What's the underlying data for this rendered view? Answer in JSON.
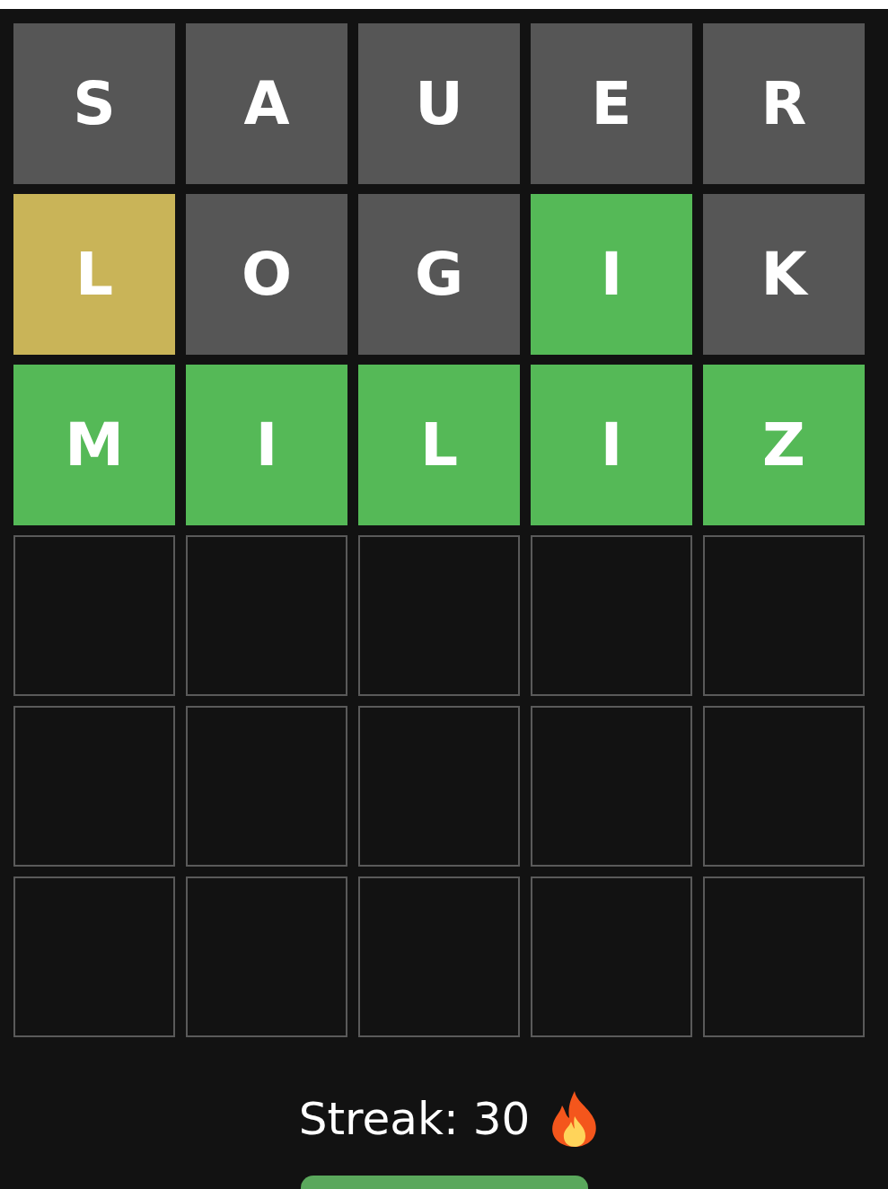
{
  "board": {
    "rows": [
      {
        "tiles": [
          {
            "letter": "S",
            "kind": "absent"
          },
          {
            "letter": "A",
            "kind": "absent"
          },
          {
            "letter": "U",
            "kind": "absent"
          },
          {
            "letter": "E",
            "kind": "absent"
          },
          {
            "letter": "R",
            "kind": "absent"
          }
        ]
      },
      {
        "tiles": [
          {
            "letter": "L",
            "kind": "present"
          },
          {
            "letter": "O",
            "kind": "absent"
          },
          {
            "letter": "G",
            "kind": "absent"
          },
          {
            "letter": "I",
            "kind": "correct"
          },
          {
            "letter": "K",
            "kind": "absent"
          }
        ]
      },
      {
        "tiles": [
          {
            "letter": "M",
            "kind": "correct"
          },
          {
            "letter": "I",
            "kind": "correct"
          },
          {
            "letter": "L",
            "kind": "correct"
          },
          {
            "letter": "I",
            "kind": "correct"
          },
          {
            "letter": "Z",
            "kind": "correct"
          }
        ]
      },
      {
        "tiles": [
          {
            "kind": "empty"
          },
          {
            "kind": "empty"
          },
          {
            "kind": "empty"
          },
          {
            "kind": "empty"
          },
          {
            "kind": "empty"
          }
        ]
      },
      {
        "tiles": [
          {
            "kind": "empty"
          },
          {
            "kind": "empty"
          },
          {
            "kind": "empty"
          },
          {
            "kind": "empty"
          },
          {
            "kind": "empty"
          }
        ]
      },
      {
        "tiles": [
          {
            "kind": "empty"
          },
          {
            "kind": "empty"
          },
          {
            "kind": "empty"
          },
          {
            "kind": "empty"
          },
          {
            "kind": "empty"
          }
        ]
      }
    ]
  },
  "streak": {
    "label": "Streak: 30"
  }
}
